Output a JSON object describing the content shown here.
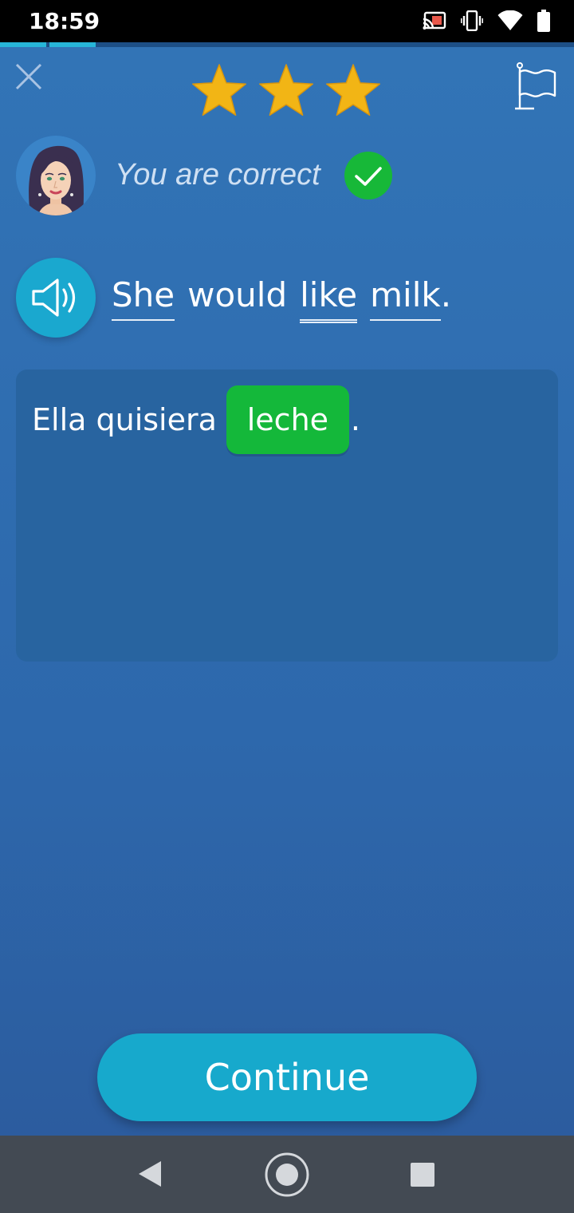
{
  "status_bar": {
    "time": "18:59",
    "icons": [
      "cast-icon",
      "vibrate-icon",
      "wifi-icon",
      "battery-icon"
    ]
  },
  "progress": {
    "fraction": 0.167
  },
  "header": {
    "close_icon": "close-icon",
    "stars_count": 3,
    "star_color": "#f2b515",
    "flag_icon": "flag-icon"
  },
  "feedback": {
    "text": "You are correct",
    "status_color": "#17b838"
  },
  "prompt": {
    "words": [
      "She",
      "would",
      "like",
      "milk",
      "."
    ]
  },
  "answer": {
    "before": "Ella quisiera",
    "chip": "leche",
    "after": "."
  },
  "actions": {
    "continue_label": "Continue"
  },
  "colors": {
    "accent": "#17a9cc",
    "success": "#14b83a",
    "background": "#3275b7"
  }
}
